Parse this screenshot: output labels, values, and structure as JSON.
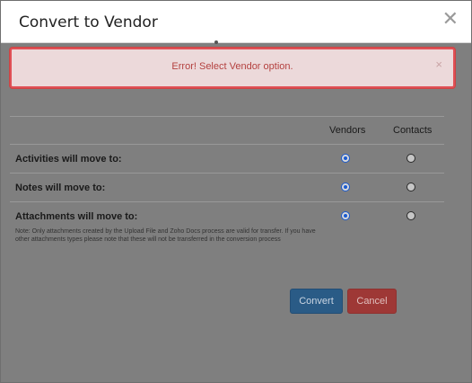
{
  "dialog": {
    "title": "Convert to Vendor",
    "close_icon": "close-icon"
  },
  "alert": {
    "message": "Error! Select Vendor option.",
    "close_symbol": "×"
  },
  "table": {
    "columns": [
      "Vendors",
      "Contacts"
    ],
    "rows": [
      {
        "label": "Activities will move to:",
        "vendors_selected": true,
        "contacts_selected": false
      },
      {
        "label": "Notes will move to:",
        "vendors_selected": true,
        "contacts_selected": false
      },
      {
        "label": "Attachments will move to:",
        "vendors_selected": true,
        "contacts_selected": false,
        "note": "Note: Only attachments created by the Upload File and Zoho Docs process are valid for transfer. If you have other attachments types please note that these will not be transferred in the conversion process"
      }
    ]
  },
  "buttons": {
    "convert": "Convert",
    "cancel": "Cancel"
  },
  "colors": {
    "alert_border": "#e05056",
    "alert_text": "#b4413f",
    "radio_selected": "#1b5bd0",
    "convert_button": "#2a5b86",
    "cancel_button": "#9e3836"
  }
}
